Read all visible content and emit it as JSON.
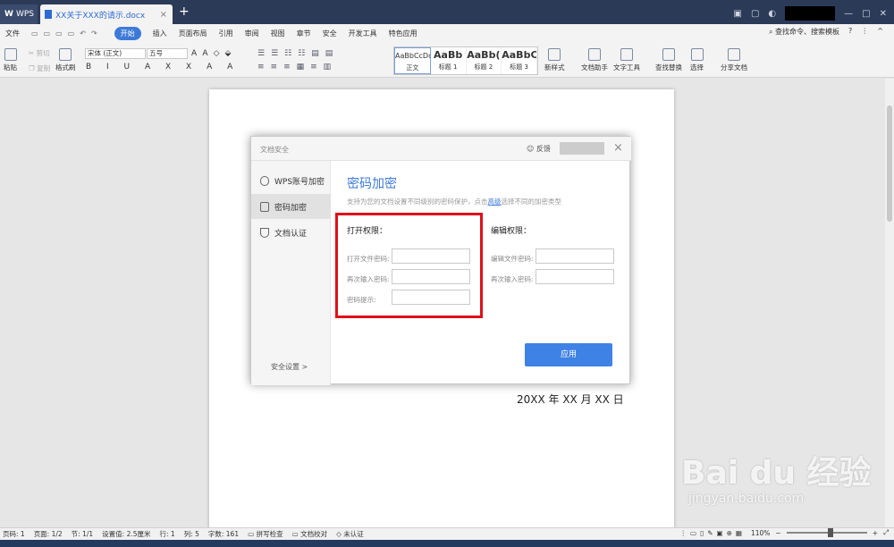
{
  "titlebar": {
    "app_tab": "WPS",
    "doc_tab": "XX关于XXX的请示.docx",
    "new_tab": "+"
  },
  "menu": {
    "file": "文件",
    "start": "开始",
    "items": [
      "插入",
      "页面布局",
      "引用",
      "审阅",
      "视图",
      "章节",
      "安全",
      "开发工具",
      "特色应用"
    ],
    "search": "查找命令、搜索模板",
    "help": "?"
  },
  "ribbon": {
    "paste": "粘贴",
    "cut": "剪切",
    "copy": "复制",
    "format_painter": "格式刷",
    "font": "宋体 (正文)",
    "size": "五号",
    "styles": [
      {
        "label": "正文",
        "sample": "AaBbCcDd"
      },
      {
        "label": "标题 1",
        "sample": "AaBb"
      },
      {
        "label": "标题 2",
        "sample": "AaBb("
      },
      {
        "label": "标题 3",
        "sample": "AaBbC"
      }
    ],
    "new_style": "新样式",
    "doc_helper": "文档助手",
    "text_tools": "文字工具",
    "find_replace": "查找替换",
    "select": "选择",
    "share": "分享文档"
  },
  "document": {
    "date_line": "20XX 年 XX 月 XX 日"
  },
  "dialog": {
    "title": "文档安全",
    "feedback": "反馈",
    "close": "×",
    "sidebar": [
      {
        "label": "WPS账号加密",
        "icon": "user-icon"
      },
      {
        "label": "密码加密",
        "icon": "lock-icon"
      },
      {
        "label": "文档认证",
        "icon": "shield-icon"
      }
    ],
    "security_settings": "安全设置 >",
    "heading": "密码加密",
    "desc_before": "支持为您的文档设置不同级别的密码保护，点击",
    "desc_link": "高级",
    "desc_after": "选择不同的加密类型",
    "open_title": "打开权限：",
    "open_pw": "打开文件密码:",
    "open_repeat": "再次输入密码:",
    "hint": "密码提示:",
    "edit_title": "编辑权限：",
    "edit_pw": "编辑文件密码:",
    "edit_repeat": "再次输入密码:",
    "apply": "应用"
  },
  "status": {
    "page": "页码: 1",
    "pages": "页面: 1/2",
    "section": "节: 1/1",
    "setting": "设置值: 2.5厘米",
    "row": "行: 1",
    "col": "列: 5",
    "words": "字数: 161",
    "spell": "拼写检查",
    "proof": "文档校对",
    "cert": "未认证",
    "zoom": "110%",
    "zoom_fraction": 0.55
  },
  "watermark": {
    "main": "Bai du 经验",
    "sub": "jingyan.baidu.com"
  },
  "colors": {
    "accent": "#3d7ad8",
    "highlight": "#e00f18",
    "titlebar": "#2b3a57"
  }
}
